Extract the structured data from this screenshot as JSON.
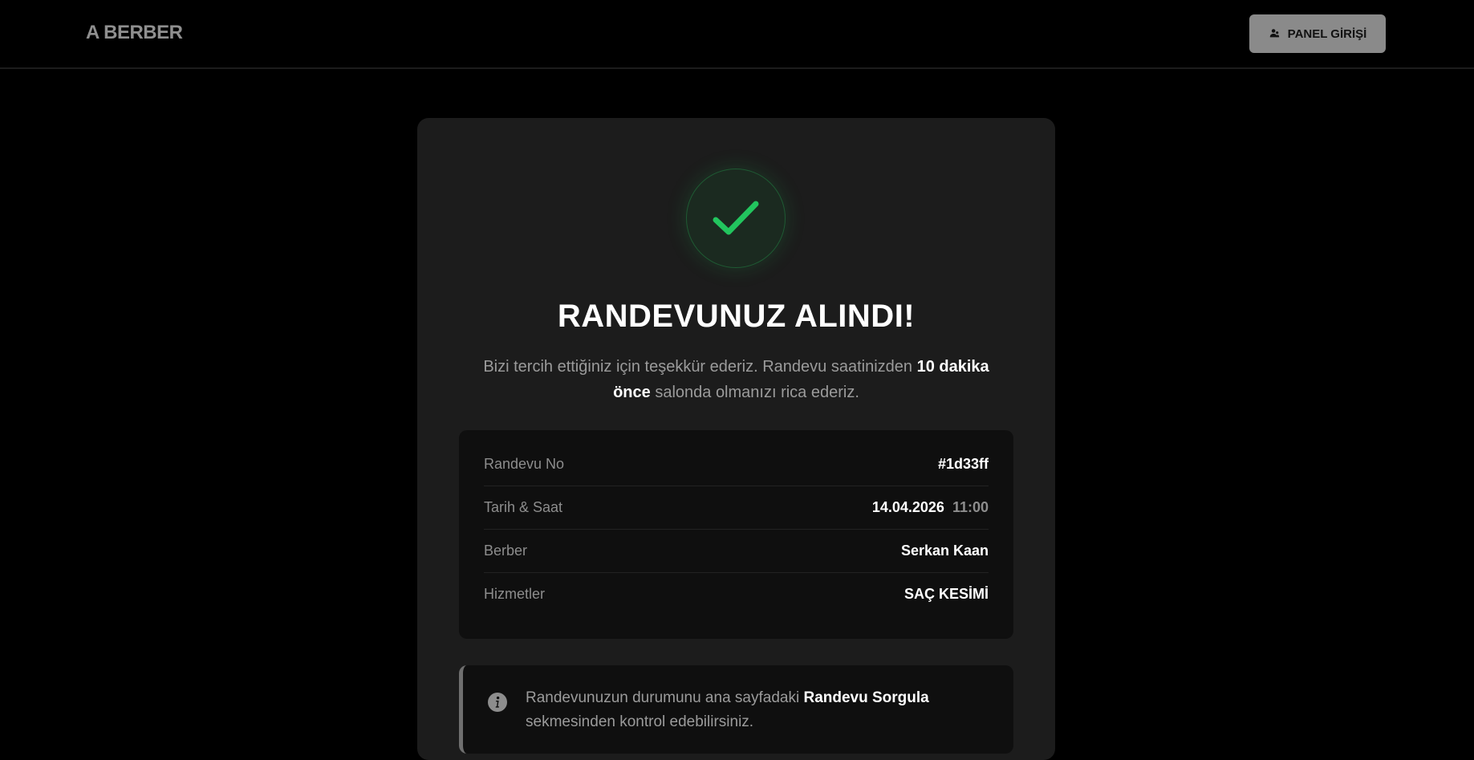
{
  "header": {
    "logo": "A BERBER",
    "panel_button_label": "PANEL GİRİŞİ"
  },
  "confirmation": {
    "title": "RANDEVUNUZ ALINDI!",
    "subtitle_pre": "Bizi tercih ettiğiniz için teşekkür ederiz. Randevu saatinizden ",
    "subtitle_bold": "10 dakika önce",
    "subtitle_post": " salonda olmanızı rica ederiz."
  },
  "details": {
    "rows": [
      {
        "label": "Randevu No",
        "value": "#1d33ff"
      },
      {
        "label": "Tarih & Saat",
        "value": "14.04.2026",
        "extra": "11:00"
      },
      {
        "label": "Berber",
        "value": "Serkan Kaan"
      },
      {
        "label": "Hizmetler",
        "value": "SAÇ KESİMİ"
      }
    ]
  },
  "info": {
    "text_pre": "Randevunuzun durumunu ana sayfadaki ",
    "text_bold": "Randevu Sorgula",
    "text_post": " sekmesinden kontrol edebilirsiniz."
  },
  "colors": {
    "success": "#22c55e",
    "background": "#000000",
    "card": "#1c1c1c",
    "panel": "#0f0f0f",
    "button": "#8a8a8a"
  },
  "icons": {
    "panel_button": "user-group-icon",
    "confirmation": "check-icon",
    "info": "info-icon"
  }
}
